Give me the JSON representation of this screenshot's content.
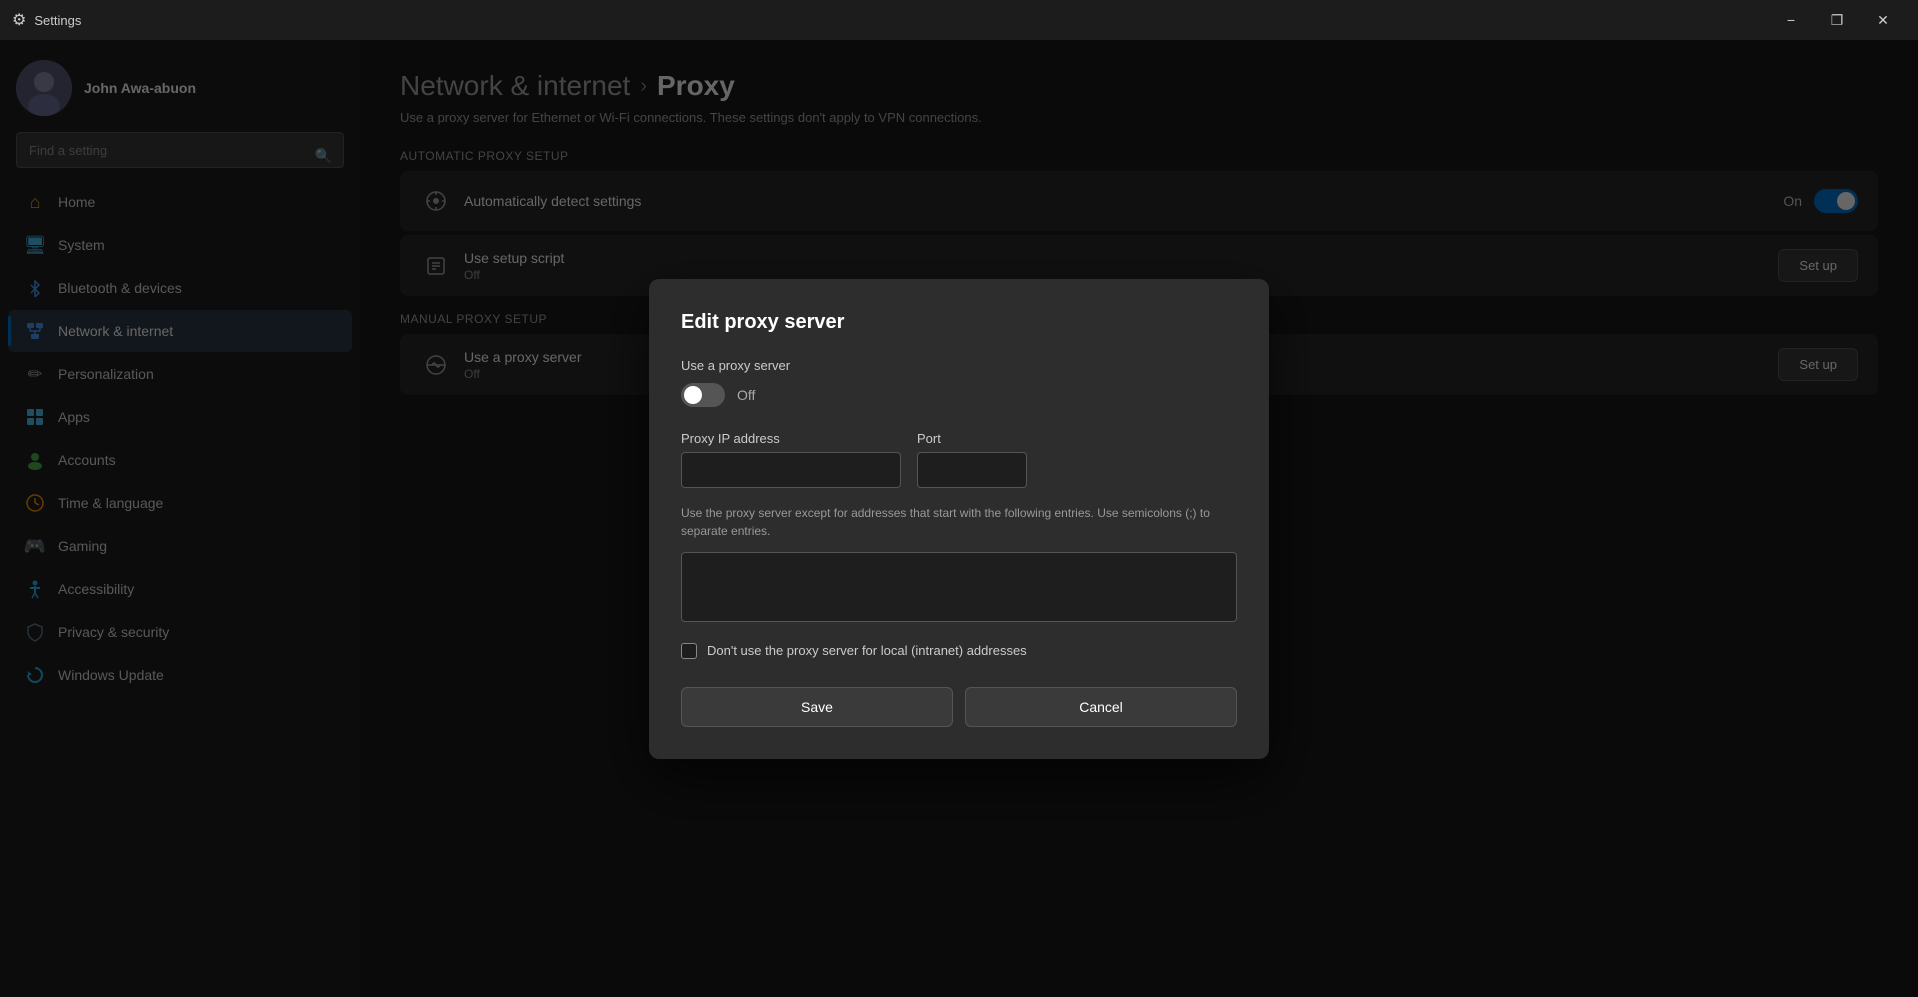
{
  "titlebar": {
    "title": "Settings",
    "minimize_label": "−",
    "restore_label": "❐",
    "close_label": "✕"
  },
  "sidebar": {
    "profile": {
      "name": "John Awa-abuon"
    },
    "search": {
      "placeholder": "Find a setting"
    },
    "nav_items": [
      {
        "id": "home",
        "label": "Home",
        "icon": "⌂",
        "icon_name": "home-icon",
        "active": false
      },
      {
        "id": "system",
        "label": "System",
        "icon": "🖥",
        "icon_name": "system-icon",
        "active": false
      },
      {
        "id": "bluetooth",
        "label": "Bluetooth & devices",
        "icon": "⬡",
        "icon_name": "bluetooth-icon",
        "active": false
      },
      {
        "id": "network",
        "label": "Network & internet",
        "icon": "🌐",
        "icon_name": "network-icon",
        "active": true
      },
      {
        "id": "personalization",
        "label": "Personalization",
        "icon": "✏",
        "icon_name": "personalization-icon",
        "active": false
      },
      {
        "id": "apps",
        "label": "Apps",
        "icon": "⊞",
        "icon_name": "apps-icon",
        "active": false
      },
      {
        "id": "accounts",
        "label": "Accounts",
        "icon": "👤",
        "icon_name": "accounts-icon",
        "active": false
      },
      {
        "id": "time",
        "label": "Time & language",
        "icon": "🌐",
        "icon_name": "time-icon",
        "active": false
      },
      {
        "id": "gaming",
        "label": "Gaming",
        "icon": "🎮",
        "icon_name": "gaming-icon",
        "active": false
      },
      {
        "id": "accessibility",
        "label": "Accessibility",
        "icon": "♿",
        "icon_name": "accessibility-icon",
        "active": false
      },
      {
        "id": "privacy",
        "label": "Privacy & security",
        "icon": "🛡",
        "icon_name": "privacy-icon",
        "active": false
      },
      {
        "id": "update",
        "label": "Windows Update",
        "icon": "↻",
        "icon_name": "update-icon",
        "active": false
      }
    ]
  },
  "content": {
    "breadcrumb": {
      "parent": "Network & internet",
      "separator": "›",
      "current": "Proxy"
    },
    "description": "Use a proxy server for Ethernet or Wi-Fi connections. These settings don't apply to VPN connections.",
    "sections": [
      {
        "label": "Automatic proxy setup",
        "rows": [
          {
            "id": "auto-detect",
            "icon": "⚙",
            "title": "Automatically detect settings",
            "sub": "",
            "control_type": "toggle",
            "toggle_state": "on",
            "toggle_label_on": "On",
            "toggle_label_off": "Off"
          },
          {
            "id": "setup-script",
            "icon": "⚙",
            "title": "Use setup script",
            "sub": "Off",
            "control_type": "button",
            "button_label": "Set up"
          }
        ]
      },
      {
        "label": "Manual proxy setup",
        "rows": [
          {
            "id": "manual-proxy",
            "icon": "⚙",
            "title": "Use a proxy server",
            "sub": "Off",
            "control_type": "button",
            "button_label": "Set up"
          }
        ]
      }
    ]
  },
  "dialog": {
    "title": "Edit proxy server",
    "use_proxy_label": "Use a proxy server",
    "toggle_state": "off",
    "toggle_label": "Off",
    "proxy_ip_label": "Proxy IP address",
    "proxy_ip_value": "",
    "port_label": "Port",
    "port_value": "",
    "hint_text": "Use the proxy server except for addresses that start with the following entries. Use semicolons (;) to separate entries.",
    "exceptions_value": "",
    "checkbox_label": "Don't use the proxy server for local (intranet) addresses",
    "checkbox_checked": false,
    "save_label": "Save",
    "cancel_label": "Cancel"
  }
}
